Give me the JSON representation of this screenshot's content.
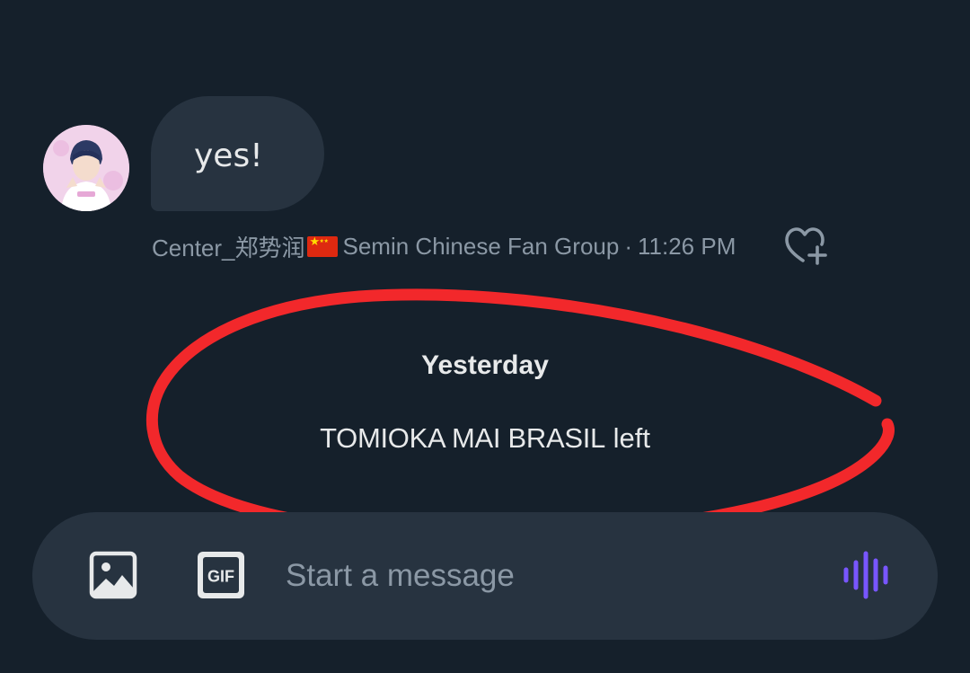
{
  "message": {
    "text": "yes!",
    "sender": "Center_郑势润",
    "group": "Semin Chinese Fan Group",
    "separator": "·",
    "time": "11:26 PM"
  },
  "date_separator": "Yesterday",
  "event": {
    "name": "TOMIOKA MAI BRASIL",
    "action": "left"
  },
  "composer": {
    "placeholder": "Start a message",
    "gif_label": "GIF"
  },
  "icons": {
    "image": "image-icon",
    "gif": "gif-icon",
    "voice": "voice-icon",
    "react": "heart-plus-icon",
    "flag": "china-flag-icon"
  },
  "colors": {
    "background": "#15202b",
    "bubble": "#273340",
    "meta_text": "#8b98a5",
    "accent_voice": "#7856ff",
    "annotation": "#f2282b"
  }
}
